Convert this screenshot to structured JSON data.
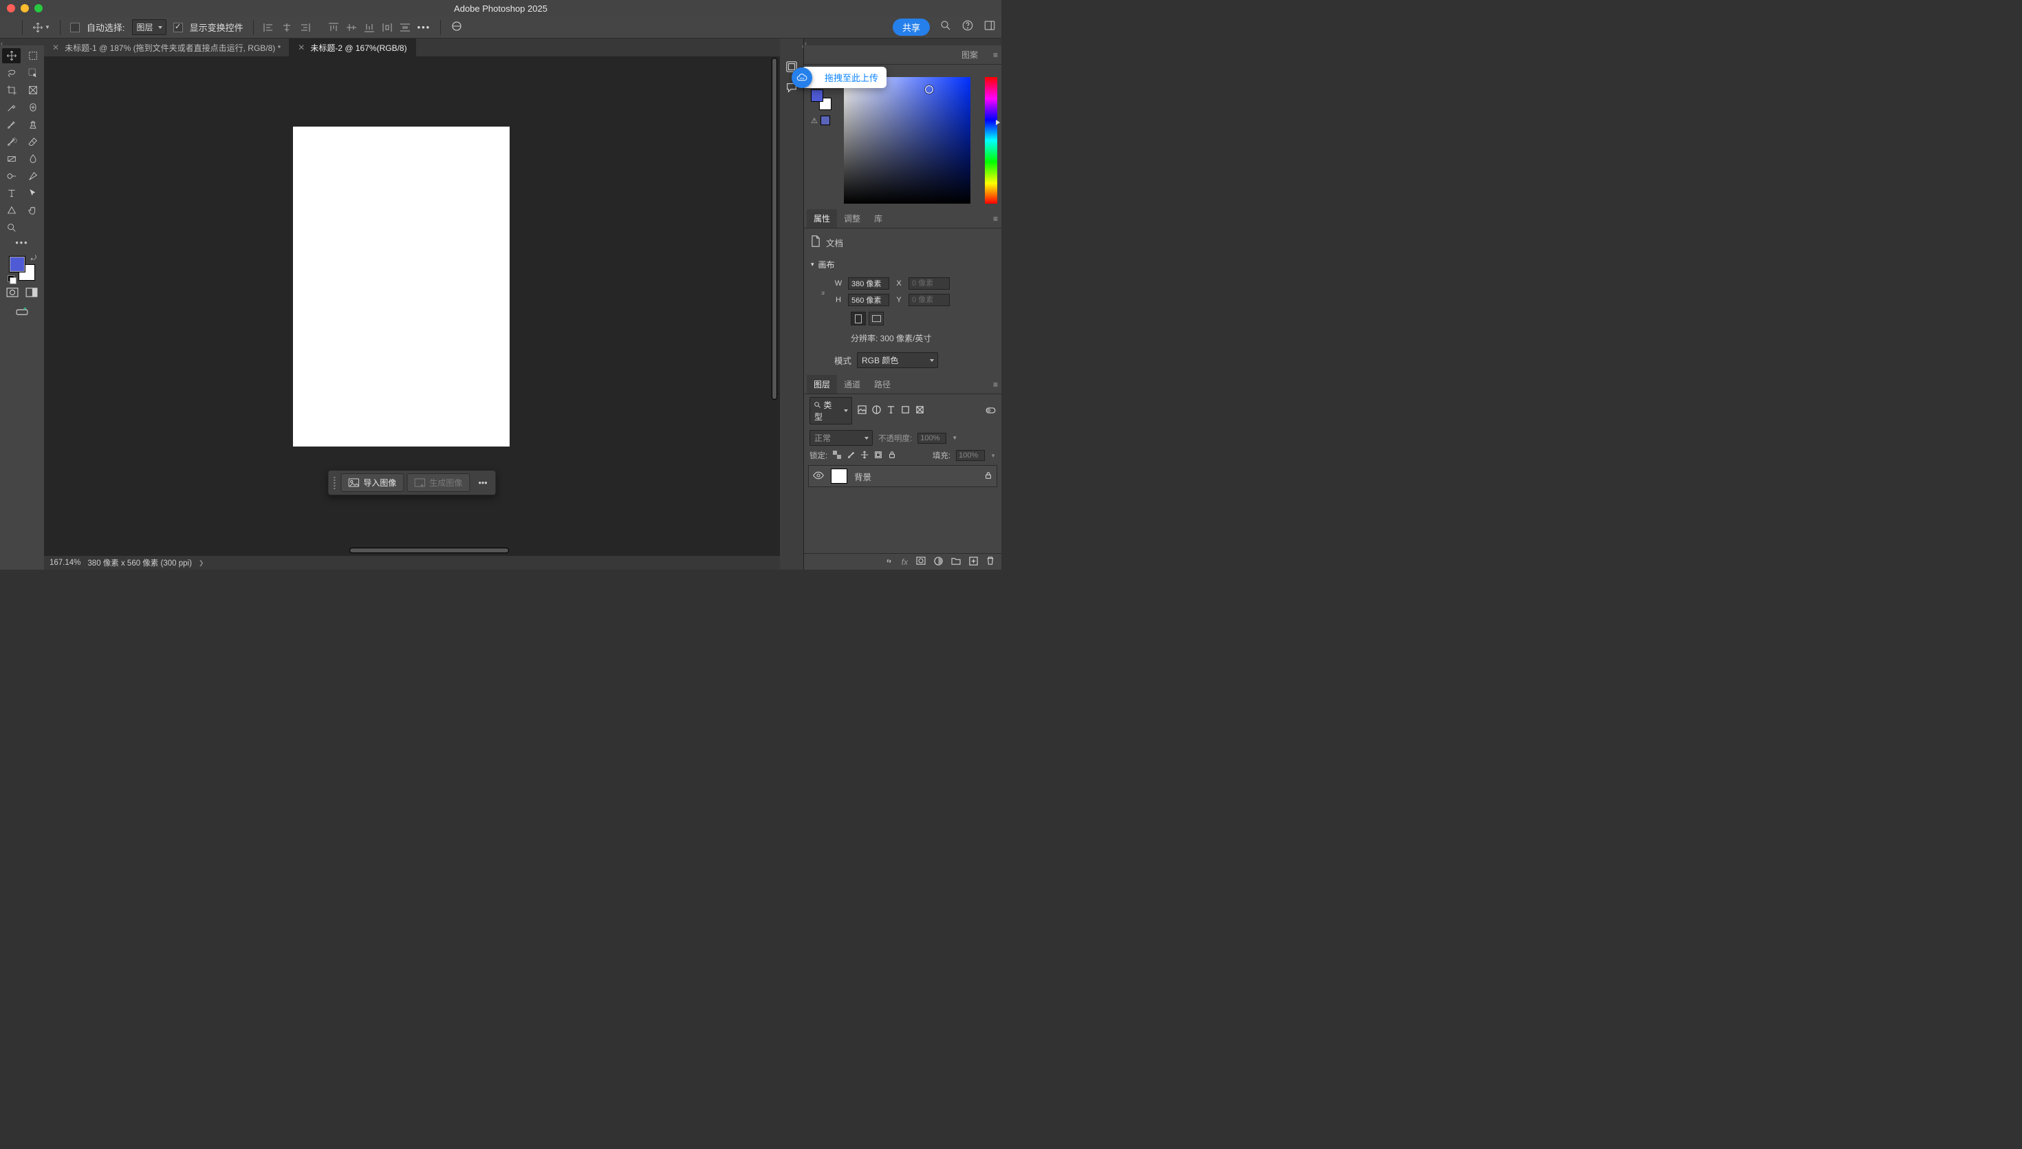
{
  "app_title": "Adobe Photoshop 2025",
  "options_bar": {
    "auto_select_label": "自动选择:",
    "auto_select_target": "图层",
    "show_transform_label": "显示变换控件",
    "share_label": "共享"
  },
  "doc_tabs": [
    {
      "label": "未标题-1 @ 187% (拖到文件夹或者直接点击运行, RGB/8) *",
      "active": false
    },
    {
      "label": "未标题-2 @ 167%(RGB/8)",
      "active": true
    }
  ],
  "context_bar": {
    "import_label": "导入图像",
    "generate_label": "生成图像"
  },
  "status": {
    "zoom": "167.14%",
    "info": "380 像素 x 560 像素 (300 ppi)"
  },
  "right_tabs": {
    "color_extra_tab": "图案",
    "drag_tooltip": "拖拽至此上传"
  },
  "properties_panel": {
    "tab_props": "属性",
    "tab_adjust": "调整",
    "tab_lib": "库",
    "doc_label": "文档",
    "canvas_label": "画布",
    "w_label": "W",
    "h_label": "H",
    "x_label": "X",
    "y_label": "Y",
    "w_value": "380 像素",
    "h_value": "560 像素",
    "x_placeholder": "0 像素",
    "y_placeholder": "0 像素",
    "resolution": "分辨率: 300 像素/英寸",
    "mode_label": "模式",
    "mode_value": "RGB 颜色"
  },
  "layers_panel": {
    "tab_layers": "图层",
    "tab_channels": "通道",
    "tab_paths": "路径",
    "filter_kind": "类型",
    "blend_mode": "正常",
    "opacity_label": "不透明度:",
    "opacity_value": "100%",
    "lock_label": "锁定:",
    "fill_label": "填充:",
    "fill_value": "100%",
    "layers": [
      {
        "name": "背景",
        "locked": true
      }
    ]
  }
}
